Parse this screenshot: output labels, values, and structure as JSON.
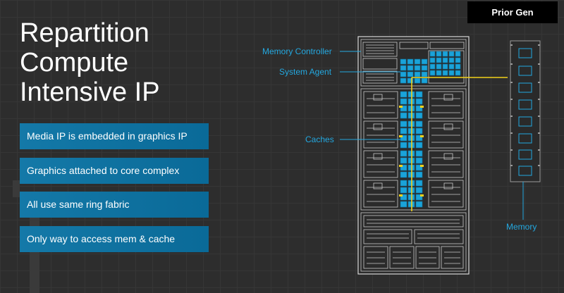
{
  "title": {
    "line1": "Repartition",
    "line2": "Compute",
    "line3": "Intensive IP"
  },
  "bullets": [
    {
      "text": "Media IP is embedded in graphics IP"
    },
    {
      "text": "Graphics attached to core complex"
    },
    {
      "text": "All use same ring fabric"
    },
    {
      "text": "Only way to access  mem & cache"
    }
  ],
  "badge": {
    "label": "Prior Gen"
  },
  "diagram": {
    "memory_controller": "Memory Controller",
    "system_agent": "System Agent",
    "caches": "Caches",
    "memory": "Memory"
  },
  "colors": {
    "accent": "#23a8e0",
    "bullet_bg": "#0f74a3",
    "highlight_block": "#1aa3d9",
    "ring": "#f2d21a",
    "chip_line": "#d8d8d8",
    "background": "#2d2d2d"
  }
}
